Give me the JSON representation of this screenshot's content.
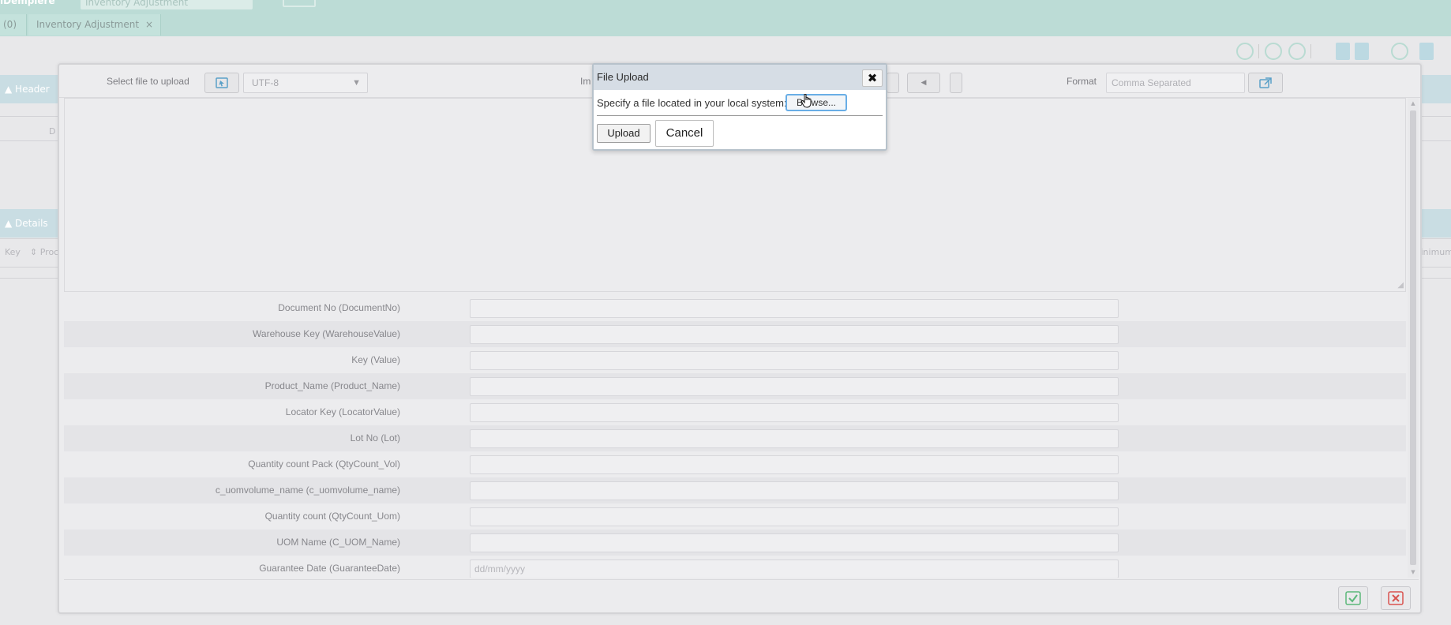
{
  "app": {
    "logo_text": "iDempiere",
    "search_placeholder": "Inventory Adjustment",
    "tabs": [
      {
        "label": "(0)"
      },
      {
        "label": "Inventory Adjustment",
        "close": "×"
      }
    ]
  },
  "background": {
    "header_section": "Header",
    "details_section": "Details",
    "header_field_fragment": "D",
    "details_col_1": "Key",
    "details_col_2": "Proc",
    "details_col_right": "Minimum"
  },
  "import_dialog": {
    "select_file_label": "Select file to upload",
    "charset_value": "UTF-8",
    "import_label_fragment": "Im",
    "format_label": "Format",
    "format_value": "Comma Separated",
    "fields": [
      {
        "label": "Document No (DocumentNo)",
        "value": ""
      },
      {
        "label": "Warehouse Key (WarehouseValue)",
        "value": ""
      },
      {
        "label": "Key (Value)",
        "value": ""
      },
      {
        "label": "Product_Name (Product_Name)",
        "value": ""
      },
      {
        "label": "Locator Key (LocatorValue)",
        "value": ""
      },
      {
        "label": "Lot No (Lot)",
        "value": ""
      },
      {
        "label": "Quantity count Pack (QtyCount_Vol)",
        "value": ""
      },
      {
        "label": "c_uomvolume_name (c_uomvolume_name)",
        "value": ""
      },
      {
        "label": "Quantity count (QtyCount_Uom)",
        "value": ""
      },
      {
        "label": "UOM Name (C_UOM_Name)",
        "value": ""
      },
      {
        "label": "Guarantee Date (GuaranteeDate)",
        "value": "",
        "placeholder": "dd/mm/yyyy"
      }
    ]
  },
  "file_upload": {
    "title": "File Upload",
    "close_glyph": "✖",
    "instruction": "Specify a file located in your local system:",
    "browse_label": "Browse...",
    "upload_label": "Upload",
    "cancel_label": "Cancel"
  },
  "colors": {
    "topbar": "#bcdcd6",
    "ok_green": "#5cb87a",
    "cancel_red": "#d9534f",
    "browse_focus": "#69aee6"
  }
}
